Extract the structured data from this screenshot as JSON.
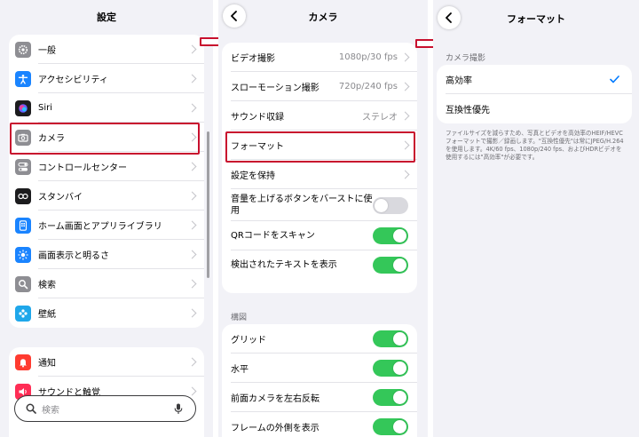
{
  "settings": {
    "title": "設定",
    "items_group1": [
      {
        "label": "一般",
        "icon": "gear-icon",
        "color": "#8e8e93"
      },
      {
        "label": "アクセシビリティ",
        "icon": "accessibility-icon",
        "color": "#1a84ff"
      },
      {
        "label": "Siri",
        "icon": "siri-icon",
        "color": "#1c1c1e"
      },
      {
        "label": "カメラ",
        "icon": "camera-icon",
        "color": "#8e8e93"
      },
      {
        "label": "コントロールセンター",
        "icon": "toggles-icon",
        "color": "#8e8e93"
      },
      {
        "label": "スタンバイ",
        "icon": "standby-icon",
        "color": "#1c1c1e"
      },
      {
        "label": "ホーム画面とアプリライブラリ",
        "icon": "home-screen-icon",
        "color": "#1a84ff"
      },
      {
        "label": "画面表示と明るさ",
        "icon": "brightness-icon",
        "color": "#1a84ff"
      },
      {
        "label": "検索",
        "icon": "search-icon",
        "color": "#8e8e93"
      },
      {
        "label": "壁紙",
        "icon": "wallpaper-icon",
        "color": "#1fa7ea"
      }
    ],
    "items_group2": [
      {
        "label": "通知",
        "icon": "bell-icon",
        "color": "#ff3b30"
      },
      {
        "label": "サウンドと触覚",
        "icon": "speaker-icon",
        "color": "#ff2d55"
      }
    ],
    "search_placeholder": "検索"
  },
  "camera": {
    "title": "カメラ",
    "group1": [
      {
        "label": "ビデオ撮影",
        "value": "1080p/30 fps",
        "type": "chevron"
      },
      {
        "label": "スローモーション撮影",
        "value": "720p/240 fps",
        "type": "chevron"
      },
      {
        "label": "サウンド収録",
        "value": "ステレオ",
        "type": "chevron"
      },
      {
        "label": "フォーマット",
        "value": "",
        "type": "chevron"
      },
      {
        "label": "設定を保持",
        "value": "",
        "type": "chevron"
      },
      {
        "label": "音量を上げるボタンをバーストに使用",
        "type": "toggle",
        "on": false
      },
      {
        "label": "QRコードをスキャン",
        "type": "toggle",
        "on": true
      },
      {
        "label": "検出されたテキストを表示",
        "type": "toggle",
        "on": true
      }
    ],
    "section2_header": "構図",
    "group2": [
      {
        "label": "グリッド",
        "on": true
      },
      {
        "label": "水平",
        "on": true
      },
      {
        "label": "前面カメラを左右反転",
        "on": true
      },
      {
        "label": "フレームの外側を表示",
        "on": true
      }
    ]
  },
  "format": {
    "title": "フォーマット",
    "section_header": "カメラ撮影",
    "options": [
      {
        "label": "高効率",
        "selected": true
      },
      {
        "label": "互換性優先",
        "selected": false
      }
    ],
    "footnote": "ファイルサイズを減らすため、写真とビデオを高効率のHEIF/HEVC フォーマットで撮影／録画します。\"互換性優先\"は常にJPEG/H.264 を使用します。4K/60 fps、1080p/240 fps、およびHDRビデオを使用するには\"高効率\"が必要です。"
  },
  "colors": {
    "accent": "#007aff",
    "toggle_on": "#34c759",
    "highlight": "#c8102e"
  }
}
